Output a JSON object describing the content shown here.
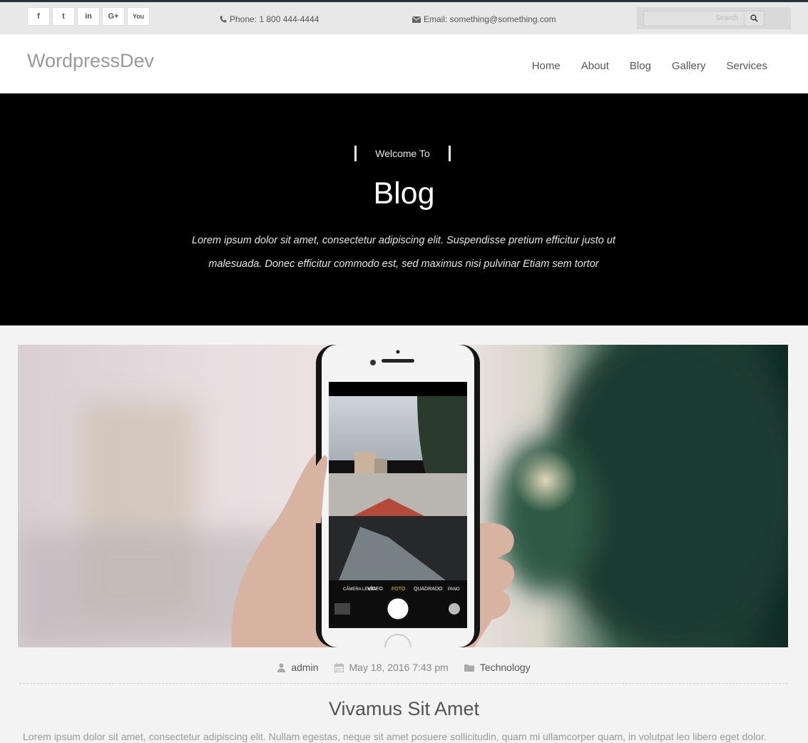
{
  "topbar": {
    "social": [
      {
        "icon": "facebook-icon",
        "glyph": "f"
      },
      {
        "icon": "twitter-icon",
        "glyph": "t"
      },
      {
        "icon": "linkedin-icon",
        "glyph": "in"
      },
      {
        "icon": "google-plus-icon",
        "glyph": "G+"
      },
      {
        "icon": "youtube-icon",
        "glyph": "You"
      }
    ],
    "phone": "Phone: 1 800 444-4444",
    "email": "Email: something@something.com",
    "search_placeholder": "Search"
  },
  "header": {
    "logo": "WordpressDev",
    "nav": [
      "Home",
      "About",
      "Blog",
      "Gallery",
      "Services"
    ]
  },
  "hero": {
    "welcome": "Welcome To",
    "title": "Blog",
    "description": "Lorem ipsum dolor sit amet, consectetur adipiscing elit. Suspendisse pretium efficitur justo ut malesuada. Donec efficitur commodo est, sed maximus nisi pulvinar Etiam sem tortor"
  },
  "post": {
    "author": "admin",
    "date": "May 18, 2016 7:43 pm",
    "category": "Technology",
    "title": "Vivamus Sit Amet",
    "excerpt": "Lorem ipsum dolor sit amet, consectetur adipiscing elit. Nullam egestas, neque sit amet posuere sollicitudin, quam mi ullamcorper quam, in volutpat leo libero eget dolor.",
    "camera_modes": [
      "CÂMERA LENTA",
      "VÍDEO",
      "FOTO",
      "QUADRADO",
      "PANO"
    ]
  }
}
